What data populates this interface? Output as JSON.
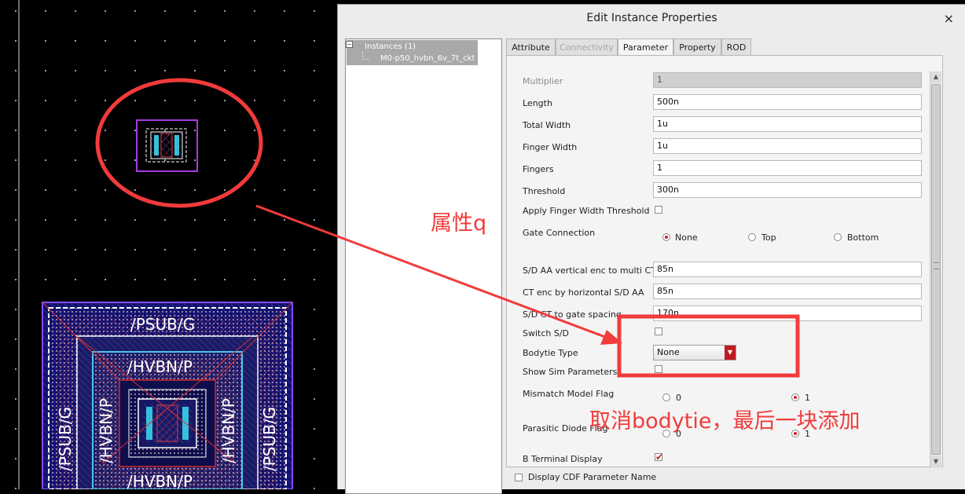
{
  "dialog": {
    "title": "Edit Instance Properties",
    "close_label": "×"
  },
  "tree": {
    "root_label": "Instances (1)",
    "expand_glyph": "⊟",
    "child_label": "M0-p50_hvbn_6v_7t_ckt"
  },
  "tabs": [
    {
      "label": "Attribute",
      "state": "normal"
    },
    {
      "label": "Connectivity",
      "state": "disabled"
    },
    {
      "label": "Parameter",
      "state": "active"
    },
    {
      "label": "Property",
      "state": "normal"
    },
    {
      "label": "ROD",
      "state": "normal"
    }
  ],
  "parameters": {
    "multiplier": {
      "label": "Multiplier",
      "value": "1"
    },
    "length": {
      "label": "Length",
      "value": "500n"
    },
    "total_width": {
      "label": "Total Width",
      "value": "1u"
    },
    "finger_width": {
      "label": "Finger Width",
      "value": "1u"
    },
    "fingers": {
      "label": "Fingers",
      "value": "1"
    },
    "threshold": {
      "label": "Threshold",
      "value": "300n"
    },
    "apply_finger_width_threshold": {
      "label": "Apply Finger Width Threshold",
      "checked": false
    },
    "gate_connection": {
      "label": "Gate Connection",
      "options": [
        "None",
        "Top",
        "Bottom"
      ],
      "selected": "None"
    },
    "sd_aa_vertical_enc": {
      "label": "S/D AA vertical enc to multi CTs",
      "value": "85n"
    },
    "ct_enc_horizontal": {
      "label": "CT enc by horizontal S/D AA",
      "value": "85n"
    },
    "sd_ct_gate_spacing": {
      "label": "S/D CT to gate spacing",
      "value": "170n"
    },
    "switch_sd": {
      "label": "Switch S/D",
      "checked": false
    },
    "bodytie_type": {
      "label": "Bodytie Type",
      "value": "None"
    },
    "show_sim_parameters": {
      "label": "Show Sim Parameters",
      "checked": false
    },
    "mismatch_model_flag": {
      "label": "Mismatch Model Flag",
      "options": [
        "0",
        "1"
      ],
      "selected": "1"
    },
    "parasitic_diode_flag": {
      "label": "Parasitic Diode Flag",
      "options": [
        "0",
        "1"
      ],
      "selected": "1"
    },
    "b_terminal_display": {
      "label": "B Terminal Display",
      "checked": true
    }
  },
  "footer": {
    "display_cdf_label": "Display CDF Parameter Name",
    "display_cdf_checked": false
  },
  "layout_labels": {
    "psub_top": "/PSUB/G",
    "hvbn_top": "/HVBN/P",
    "hvbn_bottom": "/HVBN/P",
    "psub_left": "/PSUB/G",
    "psub_right": "/PSUB/G",
    "hvbn_left": "/HVBN/P",
    "hvbn_right": "/HVBN/P"
  },
  "annotations": {
    "attribute_note": "属性q",
    "bodytie_note": "取消bodytie，最后一块添加",
    "color": "#f23b3b"
  },
  "colors": {
    "canvas_bg": "#000000",
    "radio_selected": "#d9212e",
    "combo_arrow": "#c01b22"
  }
}
